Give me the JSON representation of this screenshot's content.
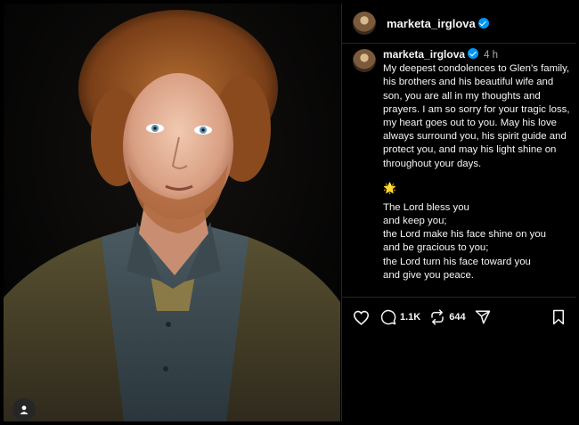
{
  "header": {
    "username": "marketa_irglova"
  },
  "comment": {
    "username": "marketa_irglova",
    "time": "4 h",
    "paragraph_1": "My deepest condolences to Glen’s family, his brothers and his beautiful wife and son, you are all in my thoughts and prayers. I am so sorry for your tragic loss, my heart goes out to you. May his love always surround you, his spirit guide and protect you, and may his light shine on throughout your days.",
    "sparkle": "🌟",
    "paragraph_2": "The Lord bless you\nand keep you;\nthe Lord make his face shine on you\nand be gracious to you;\nthe Lord turn his face toward you\nand give you peace."
  },
  "actions": {
    "comment_count": "1.1K",
    "repost_count": "644"
  },
  "colors": {
    "verified": "#0095f6",
    "border": "#262626",
    "background": "#000000"
  },
  "icons": [
    "user-tag-icon",
    "verified-badge-icon",
    "heart-icon",
    "comment-icon",
    "repost-icon",
    "share-icon",
    "bookmark-icon"
  ]
}
